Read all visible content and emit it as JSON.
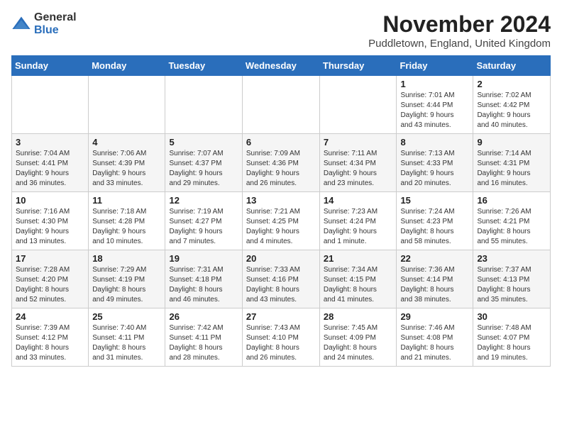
{
  "logo": {
    "general": "General",
    "blue": "Blue"
  },
  "header": {
    "month": "November 2024",
    "location": "Puddletown, England, United Kingdom"
  },
  "weekdays": [
    "Sunday",
    "Monday",
    "Tuesday",
    "Wednesday",
    "Thursday",
    "Friday",
    "Saturday"
  ],
  "weeks": [
    [
      {
        "day": "",
        "info": ""
      },
      {
        "day": "",
        "info": ""
      },
      {
        "day": "",
        "info": ""
      },
      {
        "day": "",
        "info": ""
      },
      {
        "day": "",
        "info": ""
      },
      {
        "day": "1",
        "info": "Sunrise: 7:01 AM\nSunset: 4:44 PM\nDaylight: 9 hours\nand 43 minutes."
      },
      {
        "day": "2",
        "info": "Sunrise: 7:02 AM\nSunset: 4:42 PM\nDaylight: 9 hours\nand 40 minutes."
      }
    ],
    [
      {
        "day": "3",
        "info": "Sunrise: 7:04 AM\nSunset: 4:41 PM\nDaylight: 9 hours\nand 36 minutes."
      },
      {
        "day": "4",
        "info": "Sunrise: 7:06 AM\nSunset: 4:39 PM\nDaylight: 9 hours\nand 33 minutes."
      },
      {
        "day": "5",
        "info": "Sunrise: 7:07 AM\nSunset: 4:37 PM\nDaylight: 9 hours\nand 29 minutes."
      },
      {
        "day": "6",
        "info": "Sunrise: 7:09 AM\nSunset: 4:36 PM\nDaylight: 9 hours\nand 26 minutes."
      },
      {
        "day": "7",
        "info": "Sunrise: 7:11 AM\nSunset: 4:34 PM\nDaylight: 9 hours\nand 23 minutes."
      },
      {
        "day": "8",
        "info": "Sunrise: 7:13 AM\nSunset: 4:33 PM\nDaylight: 9 hours\nand 20 minutes."
      },
      {
        "day": "9",
        "info": "Sunrise: 7:14 AM\nSunset: 4:31 PM\nDaylight: 9 hours\nand 16 minutes."
      }
    ],
    [
      {
        "day": "10",
        "info": "Sunrise: 7:16 AM\nSunset: 4:30 PM\nDaylight: 9 hours\nand 13 minutes."
      },
      {
        "day": "11",
        "info": "Sunrise: 7:18 AM\nSunset: 4:28 PM\nDaylight: 9 hours\nand 10 minutes."
      },
      {
        "day": "12",
        "info": "Sunrise: 7:19 AM\nSunset: 4:27 PM\nDaylight: 9 hours\nand 7 minutes."
      },
      {
        "day": "13",
        "info": "Sunrise: 7:21 AM\nSunset: 4:25 PM\nDaylight: 9 hours\nand 4 minutes."
      },
      {
        "day": "14",
        "info": "Sunrise: 7:23 AM\nSunset: 4:24 PM\nDaylight: 9 hours\nand 1 minute."
      },
      {
        "day": "15",
        "info": "Sunrise: 7:24 AM\nSunset: 4:23 PM\nDaylight: 8 hours\nand 58 minutes."
      },
      {
        "day": "16",
        "info": "Sunrise: 7:26 AM\nSunset: 4:21 PM\nDaylight: 8 hours\nand 55 minutes."
      }
    ],
    [
      {
        "day": "17",
        "info": "Sunrise: 7:28 AM\nSunset: 4:20 PM\nDaylight: 8 hours\nand 52 minutes."
      },
      {
        "day": "18",
        "info": "Sunrise: 7:29 AM\nSunset: 4:19 PM\nDaylight: 8 hours\nand 49 minutes."
      },
      {
        "day": "19",
        "info": "Sunrise: 7:31 AM\nSunset: 4:18 PM\nDaylight: 8 hours\nand 46 minutes."
      },
      {
        "day": "20",
        "info": "Sunrise: 7:33 AM\nSunset: 4:16 PM\nDaylight: 8 hours\nand 43 minutes."
      },
      {
        "day": "21",
        "info": "Sunrise: 7:34 AM\nSunset: 4:15 PM\nDaylight: 8 hours\nand 41 minutes."
      },
      {
        "day": "22",
        "info": "Sunrise: 7:36 AM\nSunset: 4:14 PM\nDaylight: 8 hours\nand 38 minutes."
      },
      {
        "day": "23",
        "info": "Sunrise: 7:37 AM\nSunset: 4:13 PM\nDaylight: 8 hours\nand 35 minutes."
      }
    ],
    [
      {
        "day": "24",
        "info": "Sunrise: 7:39 AM\nSunset: 4:12 PM\nDaylight: 8 hours\nand 33 minutes."
      },
      {
        "day": "25",
        "info": "Sunrise: 7:40 AM\nSunset: 4:11 PM\nDaylight: 8 hours\nand 31 minutes."
      },
      {
        "day": "26",
        "info": "Sunrise: 7:42 AM\nSunset: 4:11 PM\nDaylight: 8 hours\nand 28 minutes."
      },
      {
        "day": "27",
        "info": "Sunrise: 7:43 AM\nSunset: 4:10 PM\nDaylight: 8 hours\nand 26 minutes."
      },
      {
        "day": "28",
        "info": "Sunrise: 7:45 AM\nSunset: 4:09 PM\nDaylight: 8 hours\nand 24 minutes."
      },
      {
        "day": "29",
        "info": "Sunrise: 7:46 AM\nSunset: 4:08 PM\nDaylight: 8 hours\nand 21 minutes."
      },
      {
        "day": "30",
        "info": "Sunrise: 7:48 AM\nSunset: 4:07 PM\nDaylight: 8 hours\nand 19 minutes."
      }
    ]
  ]
}
